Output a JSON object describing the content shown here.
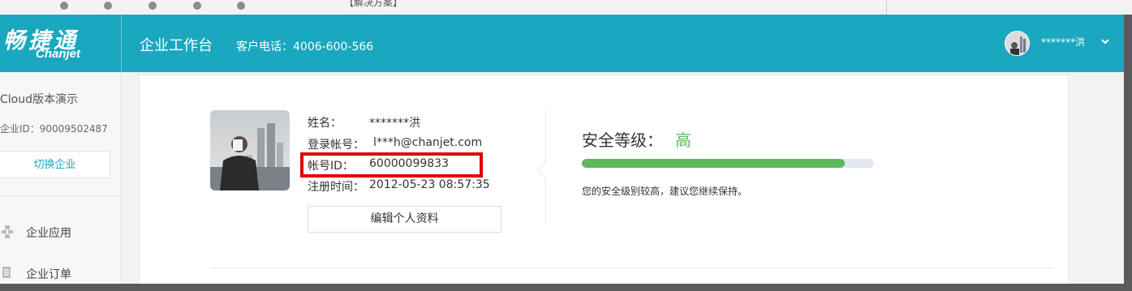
{
  "browser_strip": {
    "text": "【解决方案】"
  },
  "header": {
    "logo_cn": "畅捷通",
    "logo_en": "Chanjet",
    "title": "企业工作台",
    "phone": "客户电话：4006-600-566",
    "user": "*******洪"
  },
  "sidebar": {
    "company": "Cloud版本演示",
    "company_id": "企业ID：90009502487",
    "switch_button": "切换企业",
    "items": [
      {
        "label": "企业应用",
        "icon": "apps-icon"
      },
      {
        "label": "企业订单",
        "icon": "orders-icon"
      }
    ]
  },
  "profile": {
    "name_label": "姓名：",
    "name_value": "*******洪",
    "account_label": "登录帐号：",
    "account_value": "l***h@chanjet.com",
    "id_label": "帐号ID：",
    "id_value": "60000099833",
    "reg_label": "注册时间：",
    "reg_value": "2012-05-23 08:57:35",
    "edit_button": "编辑个人资料"
  },
  "security": {
    "title": "安全等级：",
    "level": "高",
    "progress": 0.9,
    "note": "您的安全级别较高，建议您继续保持。",
    "color": "#5cb85c"
  },
  "colors": {
    "brand": "#19a8bf",
    "highlight": "#e00000"
  }
}
